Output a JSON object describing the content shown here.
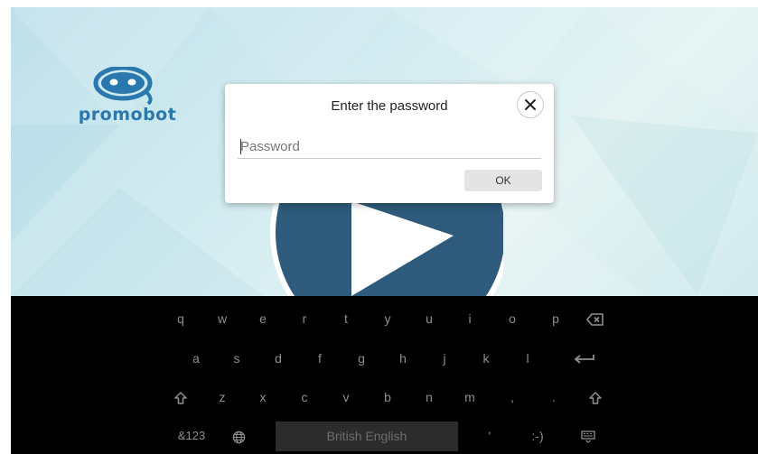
{
  "brand": {
    "logo_text": "promobot"
  },
  "dialog": {
    "title": "Enter the password",
    "password_placeholder": "Password",
    "password_value": "",
    "ok_label": "OK"
  },
  "icons": {
    "close": "close-icon",
    "play": "play-icon",
    "backspace": "backspace-icon",
    "enter": "enter-icon",
    "shift": "shift-icon",
    "globe": "globe-icon",
    "keyboard_hide": "keyboard-hide-icon"
  },
  "keyboard": {
    "row1": [
      "q",
      "w",
      "e",
      "r",
      "t",
      "y",
      "u",
      "i",
      "o",
      "p"
    ],
    "row2": [
      "a",
      "s",
      "d",
      "f",
      "g",
      "h",
      "j",
      "k",
      "l"
    ],
    "row3": [
      "z",
      "x",
      "c",
      "v",
      "b",
      "n",
      "m",
      ",",
      "."
    ],
    "symbols_label": "&123",
    "space_label": "British English",
    "apostrophe": "'",
    "smiley": ":-)"
  },
  "colors": {
    "play_circle": "#2e5b7b",
    "brand_blue": "#2a78ad",
    "keyboard_bg": "#000000"
  }
}
